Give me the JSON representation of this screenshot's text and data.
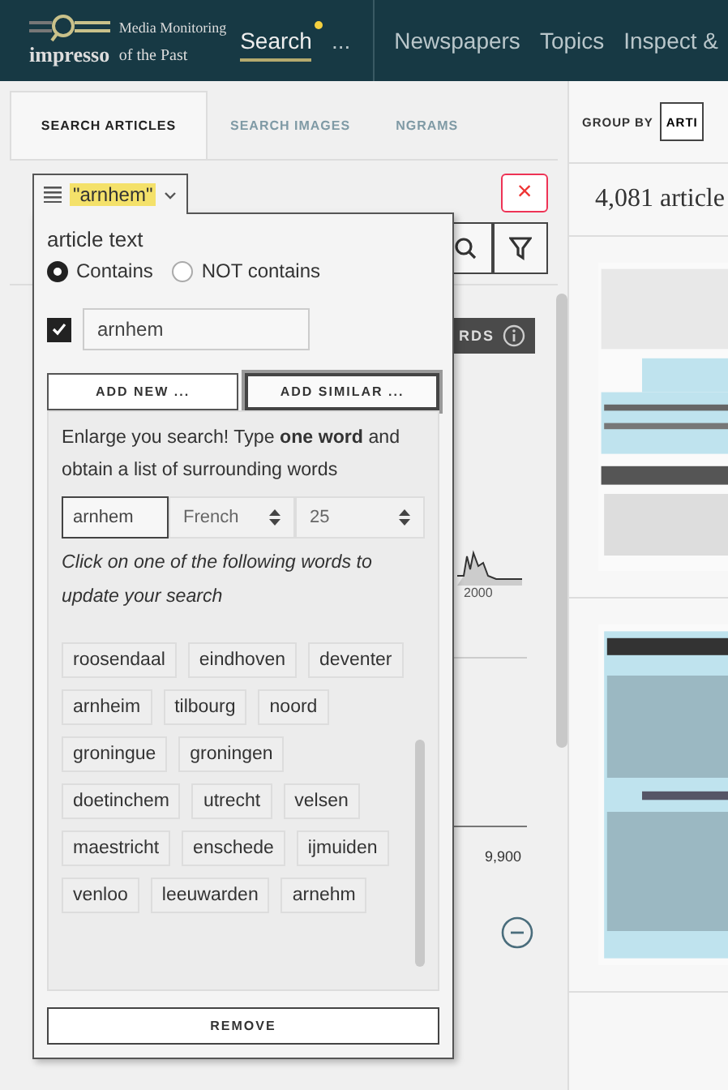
{
  "header": {
    "logo": {
      "top": "Media Monitoring",
      "brand": "impresso",
      "sub": "of the Past"
    },
    "nav": [
      {
        "label": "Search",
        "selected": true,
        "notification": true
      },
      {
        "label": "...",
        "selected": false,
        "notification": false
      },
      {
        "label": "Newspapers",
        "selected": false,
        "notification": false
      },
      {
        "label": "Topics",
        "selected": false,
        "notification": false
      },
      {
        "label": "Inspect &",
        "selected": false,
        "notification": false
      }
    ]
  },
  "tabs": [
    {
      "label": "SEARCH ARTICLES",
      "selected": true
    },
    {
      "label": "SEARCH IMAGES",
      "selected": false
    },
    {
      "label": "NGRAMS",
      "selected": false
    }
  ],
  "background": {
    "close": "×",
    "dark_button": "RDS",
    "chart_label": "2000",
    "value": "9,900"
  },
  "filter": {
    "chip": "\"arnhem\"",
    "field_label": "article text",
    "options": [
      {
        "label": "Contains",
        "selected": true
      },
      {
        "label": "NOT contains",
        "selected": false
      }
    ],
    "terms": [
      {
        "value": "arnhem",
        "checked": true
      }
    ],
    "buttons": [
      {
        "label": "ADD NEW ...",
        "active": false
      },
      {
        "label": "ADD SIMILAR ...",
        "active": true
      }
    ],
    "similar": {
      "intro": "Enlarge you search! Type **one word** and obtain a list of surrounding words",
      "word": "arnhem",
      "language": "French",
      "count": "25",
      "hint": "Click on one of the following words to update your search",
      "words": [
        "roosendaal",
        "eindhoven",
        "deventer",
        "arnheim",
        "tilbourg",
        "noord",
        "groningue",
        "groningen",
        "doetinchem",
        "utrecht",
        "velsen",
        "maestricht",
        "enschede",
        "ijmuiden",
        "venloo",
        "leeuwarden",
        "arnehm"
      ]
    },
    "remove": "REMOVE"
  },
  "right": {
    "group_by": "GROUP BY",
    "group_value": "ARTI",
    "count": "4,081 article"
  }
}
